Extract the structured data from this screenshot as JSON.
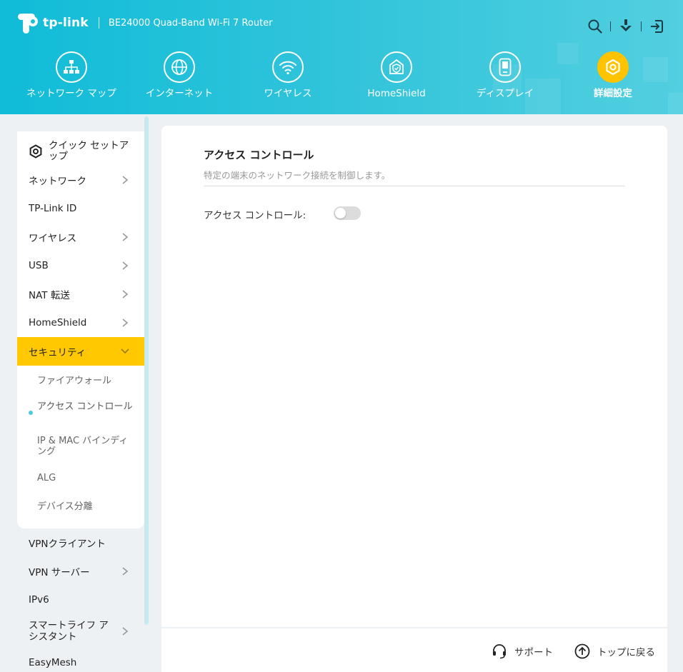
{
  "header": {
    "brand": "tp-link",
    "model": "BE24000 Quad-Band Wi-Fi 7 Router",
    "icons": [
      "search-icon",
      "app-download-icon",
      "logout-icon"
    ],
    "accent": "#ffc300"
  },
  "nav": [
    {
      "label": "ネットワーク マップ",
      "icon": "network-map-icon"
    },
    {
      "label": "インターネット",
      "icon": "globe-icon"
    },
    {
      "label": "ワイヤレス",
      "icon": "wifi-icon"
    },
    {
      "label": "HomeShield",
      "icon": "homeshield-icon"
    },
    {
      "label": "ディスプレイ",
      "icon": "display-icon"
    },
    {
      "label": "詳細設定",
      "icon": "advanced-gear-icon",
      "active": true
    }
  ],
  "sidebar": {
    "quick_setup": "クイック セットアップ",
    "items": [
      {
        "label": "ネットワーク"
      },
      {
        "label": "TP-Link ID"
      },
      {
        "label": "ワイヤレス"
      },
      {
        "label": "USB"
      },
      {
        "label": "NAT 転送"
      },
      {
        "label": "HomeShield"
      },
      {
        "label": "セキュリティ",
        "active": true
      },
      {
        "label": "VPNクライアント"
      },
      {
        "label": "VPN サーバー"
      },
      {
        "label": "IPv6"
      },
      {
        "label": "スマートライフ アシスタント"
      },
      {
        "label": "EasyMesh"
      }
    ],
    "security_sub": [
      {
        "label": "ファイアウォール"
      },
      {
        "label": "アクセス コントロール",
        "current": true
      },
      {
        "label": "IP & MAC バインディング"
      },
      {
        "label": "ALG"
      },
      {
        "label": "デバイス分離"
      }
    ]
  },
  "main": {
    "title": "アクセス コントロール",
    "description": "特定の端末のネットワーク接続を制御します。",
    "toggle_label": "アクセス コントロール:",
    "toggle_enabled": false
  },
  "footer": {
    "support": "サポート",
    "back_to_top": "トップに戻る"
  }
}
